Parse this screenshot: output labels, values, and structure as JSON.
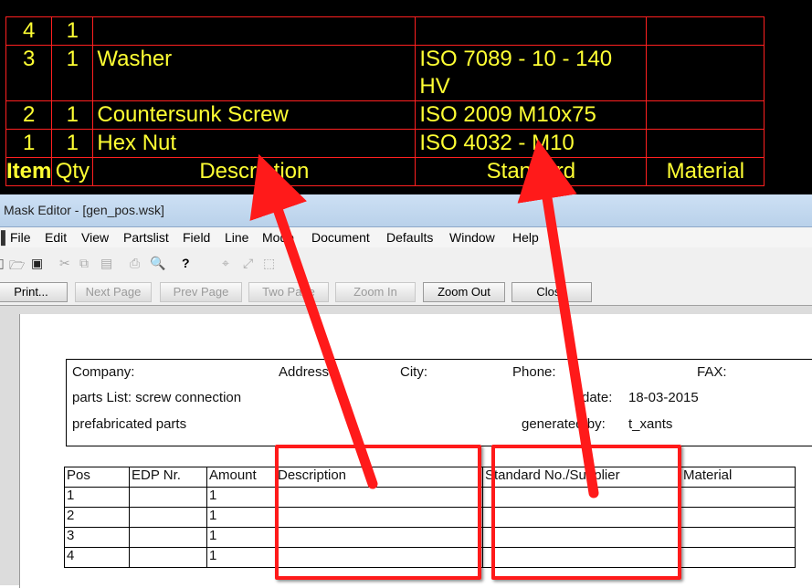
{
  "cad_parts_list": {
    "rows": [
      {
        "pos": "4",
        "qty": "1",
        "description": "",
        "standard": "",
        "material": ""
      },
      {
        "pos": "3",
        "qty": "1",
        "description": "Washer",
        "standard": "ISO 7089 - 10 - 140 HV",
        "material": ""
      },
      {
        "pos": "2",
        "qty": "1",
        "description": "Countersunk Screw",
        "standard": "ISO 2009 M10x75",
        "material": ""
      },
      {
        "pos": "1",
        "qty": "1",
        "description": "Hex Nut",
        "standard": "ISO 4032 - M10",
        "material": ""
      }
    ],
    "header": {
      "pos": "Item",
      "qty": "Qty",
      "description": "Description",
      "standard": "Standard",
      "material": "Material"
    }
  },
  "window": {
    "title": "Mask Editor - [gen_pos.wsk]"
  },
  "menu": [
    "File",
    "Edit",
    "View",
    "Partslist",
    "Field",
    "Line",
    "Mode",
    "Document",
    "Defaults",
    "Window",
    "Help"
  ],
  "buttons": {
    "print": "Print...",
    "next_page": "Next Page",
    "prev_page": "Prev Page",
    "two_page": "Two Page",
    "zoom_in": "Zoom In",
    "zoom_out": "Zoom Out",
    "close": "Close"
  },
  "info_block": {
    "company": "Company:",
    "address": "Address:",
    "city": "City:",
    "phone": "Phone:",
    "fax": "FAX:",
    "parts_list": "parts List: screw connection",
    "date_label": "date:",
    "date_value": "18-03-2015",
    "prefab": "prefabricated parts",
    "generated_label": "generated by:",
    "generated_value": "t_xants"
  },
  "mask_table": {
    "headers": [
      "Pos",
      "EDP Nr.",
      "Amount",
      "Description",
      "Standard No./Supplier",
      "Material"
    ],
    "rows": [
      [
        "1",
        "",
        "1",
        "",
        "",
        ""
      ],
      [
        "2",
        "",
        "1",
        "",
        "",
        ""
      ],
      [
        "3",
        "",
        "1",
        "",
        "",
        ""
      ],
      [
        "4",
        "",
        "1",
        "",
        "",
        ""
      ]
    ]
  },
  "colors": {
    "annotation": "#ff1a1a",
    "cad_text": "#ffff33",
    "cad_grid": "#ff2020"
  }
}
